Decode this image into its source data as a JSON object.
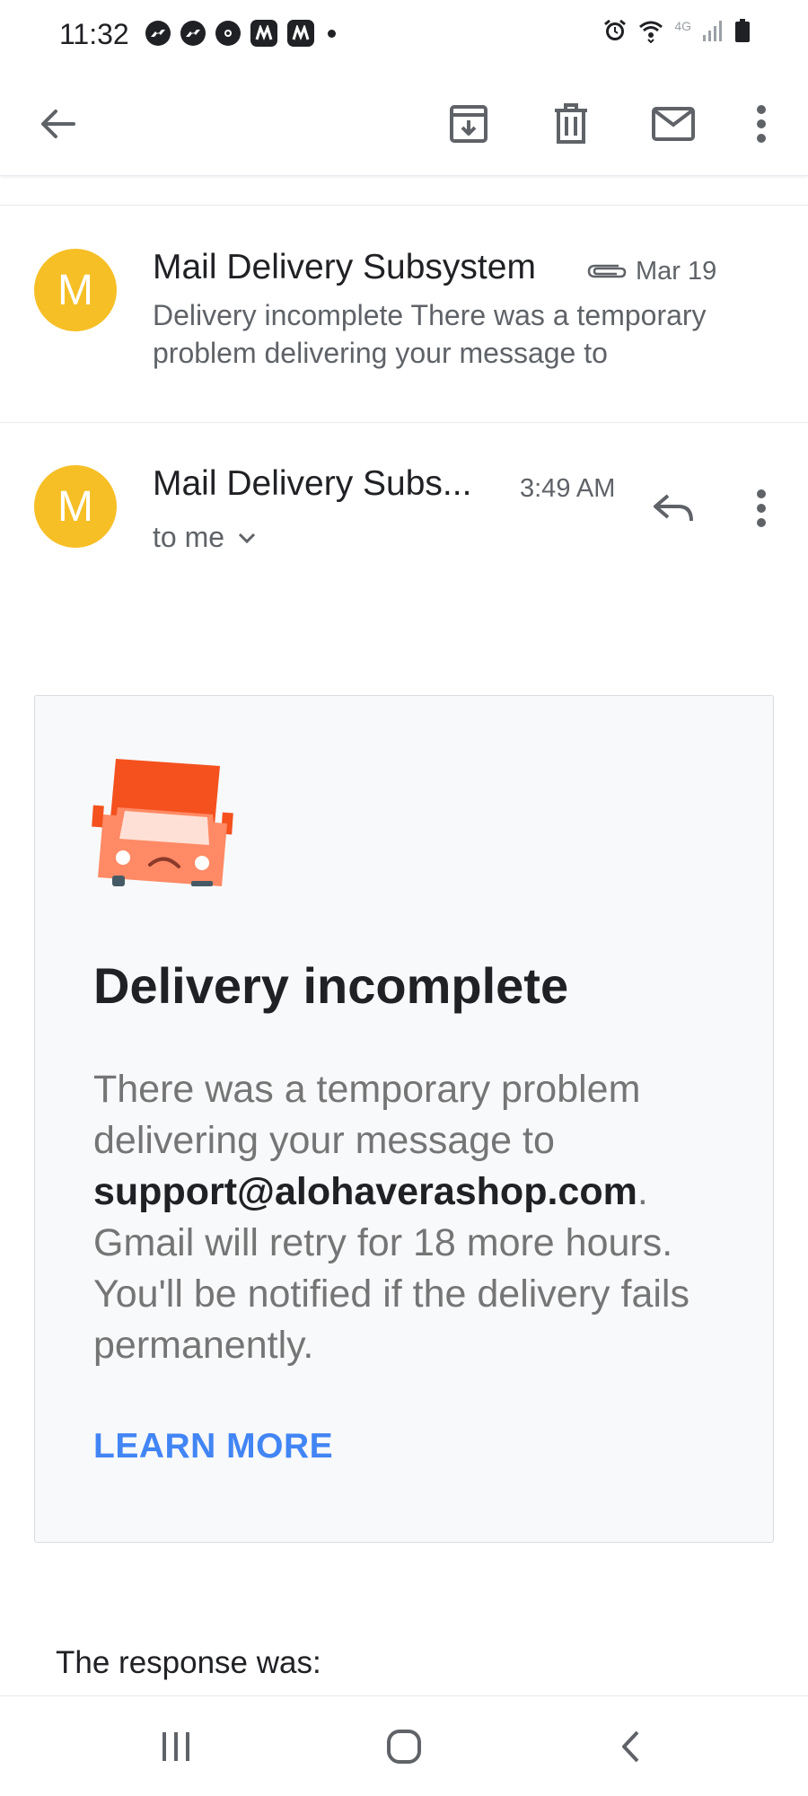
{
  "status_bar": {
    "time": "11:32",
    "network": "4G",
    "left_icons": [
      "messenger-icon",
      "messenger-icon",
      "chrome-icon",
      "app-icon",
      "app-icon",
      "dot"
    ],
    "right_icons": [
      "alarm-icon",
      "wifi-icon",
      "signal-icon",
      "battery-icon"
    ]
  },
  "toolbar": {
    "icons": [
      "back-arrow-icon",
      "archive-icon",
      "trash-icon",
      "mail-icon",
      "more-vert-icon"
    ]
  },
  "collapsed_message": {
    "avatar_letter": "M",
    "sender": "Mail Delivery Subsystem",
    "date": "Mar 19",
    "snippet": "Delivery incomplete There was a temporary problem delivering your message to",
    "has_attachment": true
  },
  "expanded_message": {
    "avatar_letter": "M",
    "sender": "Mail Delivery Subs...",
    "time": "3:49 AM",
    "recipient": "to me"
  },
  "card": {
    "title": "Delivery incomplete",
    "body_before": "There was a temporary problem delivering your message to",
    "email": "support@alohaverashop.com",
    "body_period": ".",
    "body_after": "Gmail will retry for 18 more hours. You'll be notified if the delivery fails permanently.",
    "learn_more": "LEARN MORE"
  },
  "response_label": "The response was:",
  "colors": {
    "avatar": "#f6bf26",
    "link": "#4285f4",
    "truck": "#f4511e"
  }
}
